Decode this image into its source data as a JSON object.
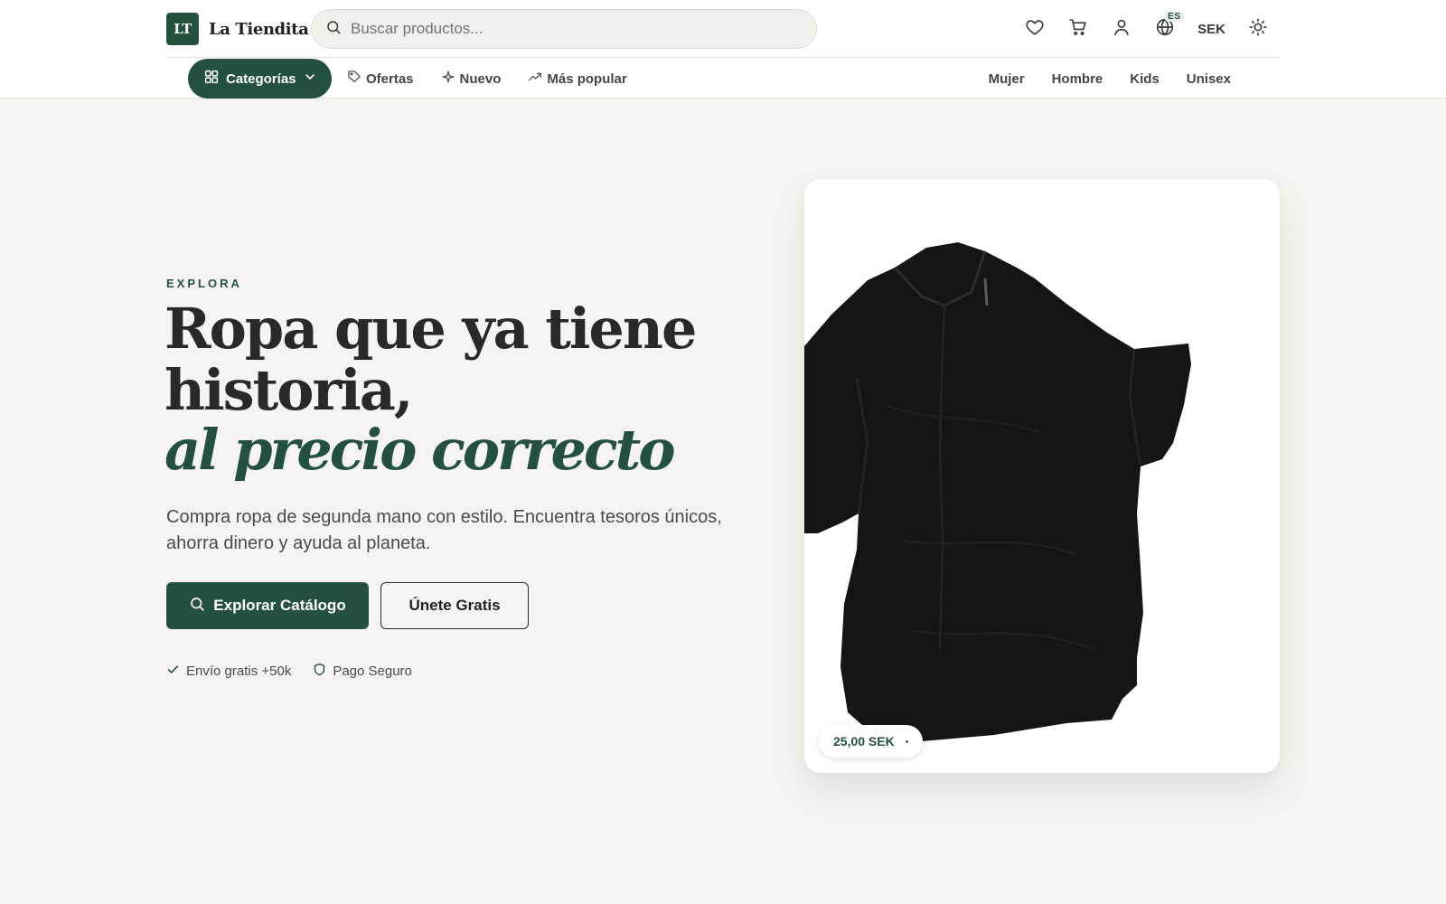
{
  "brand": {
    "logo_mark": "LT",
    "name": "La Tiendita"
  },
  "search": {
    "placeholder": "Buscar productos..."
  },
  "top_actions": {
    "language_badge": "ES",
    "currency": "SEK",
    "icons": [
      "heart-icon",
      "cart-icon",
      "user-icon",
      "globe-icon",
      "sun-icon"
    ]
  },
  "nav": {
    "categories_label": "Categorías",
    "links": [
      {
        "label": "Ofertas",
        "icon": "tag-icon"
      },
      {
        "label": "Nuevo",
        "icon": "sparkle-icon"
      },
      {
        "label": "Más popular",
        "icon": "trending-icon"
      }
    ],
    "genders": [
      "Mujer",
      "Hombre",
      "Kids",
      "Unisex"
    ]
  },
  "hero": {
    "eyebrow": "EXPLORA",
    "headline_line1": "Ropa que ya tiene",
    "headline_line2": "historia,",
    "headline_em": "al precio correcto",
    "subtext": "Compra ropa de segunda mano con estilo. Encuentra tesoros únicos, ahorra dinero y ayuda al planeta.",
    "primary_cta": "Explorar Catálogo",
    "secondary_cta": "Únete Gratis",
    "trust": [
      {
        "label": "Envío gratis +50k",
        "icon": "check-icon"
      },
      {
        "label": "Pago Seguro",
        "icon": "shield-icon"
      }
    ]
  },
  "product_card": {
    "price": "25,00 SEK"
  },
  "colors": {
    "brand_green": "#24513c",
    "background": "#f5f4ee",
    "text": "#2a2926"
  }
}
